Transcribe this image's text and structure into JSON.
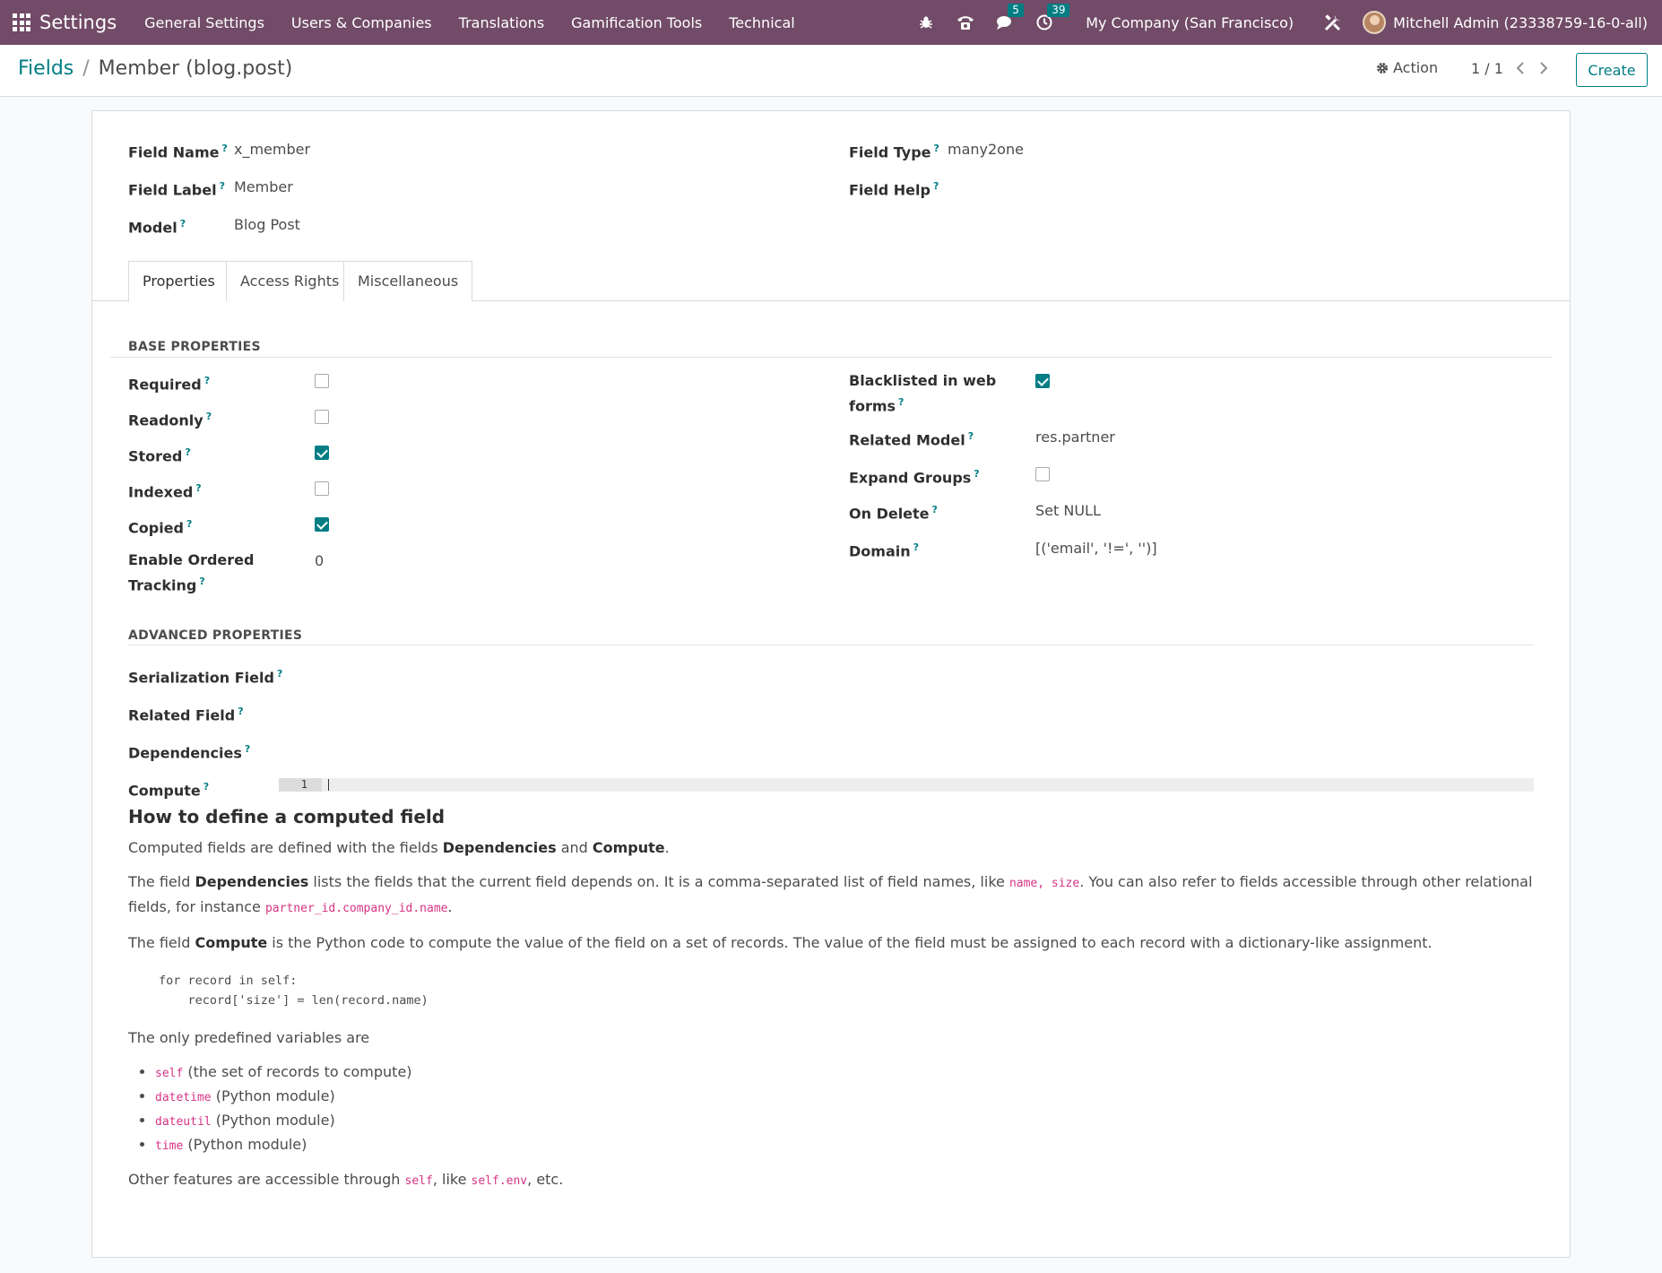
{
  "navbar": {
    "app_name": "Settings",
    "menu": [
      "General Settings",
      "Users & Companies",
      "Translations",
      "Gamification Tools",
      "Technical"
    ],
    "chat_count": "5",
    "activity_count": "39",
    "company": "My Company (San Francisco)",
    "user": "Mitchell Admin (23338759-16-0-all)",
    "accent_color": "#714b67"
  },
  "control": {
    "breadcrumb_parent": "Fields",
    "breadcrumb_sep": "/",
    "breadcrumb_current": "Member (blog.post)",
    "action_label": "Action",
    "pager": "1 / 1",
    "create_label": "Create"
  },
  "header_fields": {
    "field_name_label": "Field Name",
    "field_name": "x_member",
    "field_label_label": "Field Label",
    "field_label": "Member",
    "model_label": "Model",
    "model": "Blog Post",
    "field_type_label": "Field Type",
    "field_type": "many2one",
    "field_help_label": "Field Help",
    "help_mark": "?"
  },
  "tabs": [
    "Properties",
    "Access Rights",
    "Miscellaneous"
  ],
  "base": {
    "title": "BASE PROPERTIES",
    "required_label": "Required",
    "readonly_label": "Readonly",
    "stored_label": "Stored",
    "indexed_label": "Indexed",
    "copied_label": "Copied",
    "tracking_label_1": "Enable Ordered",
    "tracking_label_2": "Tracking",
    "tracking_value": "0",
    "blacklisted_label_1": "Blacklisted in web",
    "blacklisted_label_2": "forms",
    "related_model_label": "Related Model",
    "related_model": "res.partner",
    "expand_groups_label": "Expand Groups",
    "on_delete_label": "On Delete",
    "on_delete": "Set NULL",
    "domain_label": "Domain",
    "domain": "[('email', '!=', '')]"
  },
  "advanced": {
    "title": "ADVANCED PROPERTIES",
    "serialization_label": "Serialization Field",
    "related_field_label": "Related Field",
    "dependencies_label": "Dependencies",
    "compute_label": "Compute",
    "line_number": "1"
  },
  "help": {
    "heading": "How to define a computed field",
    "p1_a": "Computed fields are defined with the fields ",
    "p1_b": "Dependencies",
    "p1_c": " and ",
    "p1_d": "Compute",
    "p1_e": ".",
    "p2_a": "The field ",
    "p2_b": "Dependencies",
    "p2_c": " lists the fields that the current field depends on. It is a comma-separated list of field names, like ",
    "p2_code1": "name, size",
    "p2_d": ". You can also refer to fields accessible through other relational fields, for instance ",
    "p2_code2": "partner_id.company_id.name",
    "p2_e": ".",
    "p3_a": "The field ",
    "p3_b": "Compute",
    "p3_c": " is the Python code to compute the value of the field on a set of records. The value of the field must be assigned to each record with a dictionary-like assignment.",
    "code_block": "for record in self:\n    record['size'] = len(record.name)",
    "p4": "The only predefined variables are",
    "vars": [
      {
        "code": "self",
        "desc": " (the set of records to compute)"
      },
      {
        "code": "datetime",
        "desc": " (Python module)"
      },
      {
        "code": "dateutil",
        "desc": " (Python module)"
      },
      {
        "code": "time",
        "desc": " (Python module)"
      }
    ],
    "p5_a": "Other features are accessible through ",
    "p5_code1": "self",
    "p5_b": ", like ",
    "p5_code2": "self.env",
    "p5_c": ", etc."
  }
}
